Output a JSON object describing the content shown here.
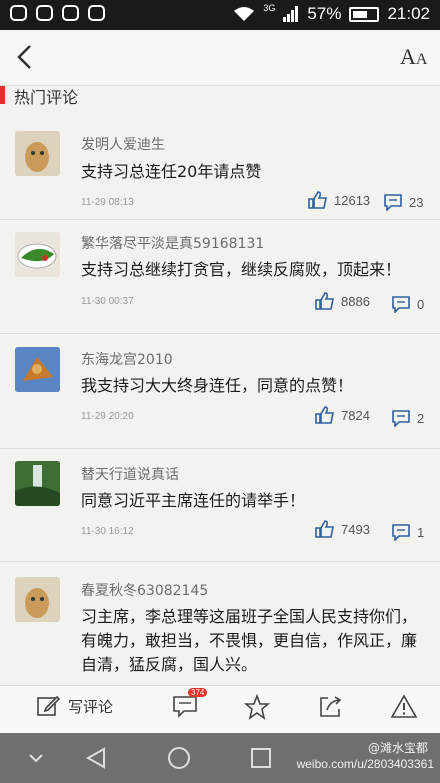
{
  "status": {
    "signal": "3G",
    "battery": "57%",
    "time": "21:02"
  },
  "section_title": "热门评论",
  "comments": [
    {
      "user": "发明人爱迪生",
      "text": "支持习总连任20年请点赞",
      "time": "11-29 08:13",
      "likes": "12613",
      "replies": "23"
    },
    {
      "user": "繁华落尽平淡是真59168131",
      "text": "支持习总继续打贪官，继续反腐败，顶起来！",
      "time": "11-30 00:37",
      "likes": "8886",
      "replies": "0"
    },
    {
      "user": "东海龙宫2010",
      "text": "我支持习大大终身连任，同意的点赞！",
      "time": "11-29 20:20",
      "likes": "7824",
      "replies": "2"
    },
    {
      "user": "替天行道说真话",
      "text": "同意习近平主席连任的请举手！",
      "time": "11-30 16:12",
      "likes": "7493",
      "replies": "1"
    },
    {
      "user": "春夏秋冬63082145",
      "text": "习主席，李总理等这届班子全国人民支持你们，有魄力，敢担当，不畏惧，更自信，作风正，廉自清，猛反腐，国人兴。",
      "time": "",
      "likes": "",
      "replies": ""
    }
  ],
  "toolbar": {
    "write_label": "写评论",
    "comment_count": "374"
  },
  "watermark": {
    "handle": "@滩水宝都",
    "url": "weibo.com/u/2803403361"
  },
  "colors": {
    "accent": "#e4322b",
    "icon_blue": "#2f5f9e"
  }
}
